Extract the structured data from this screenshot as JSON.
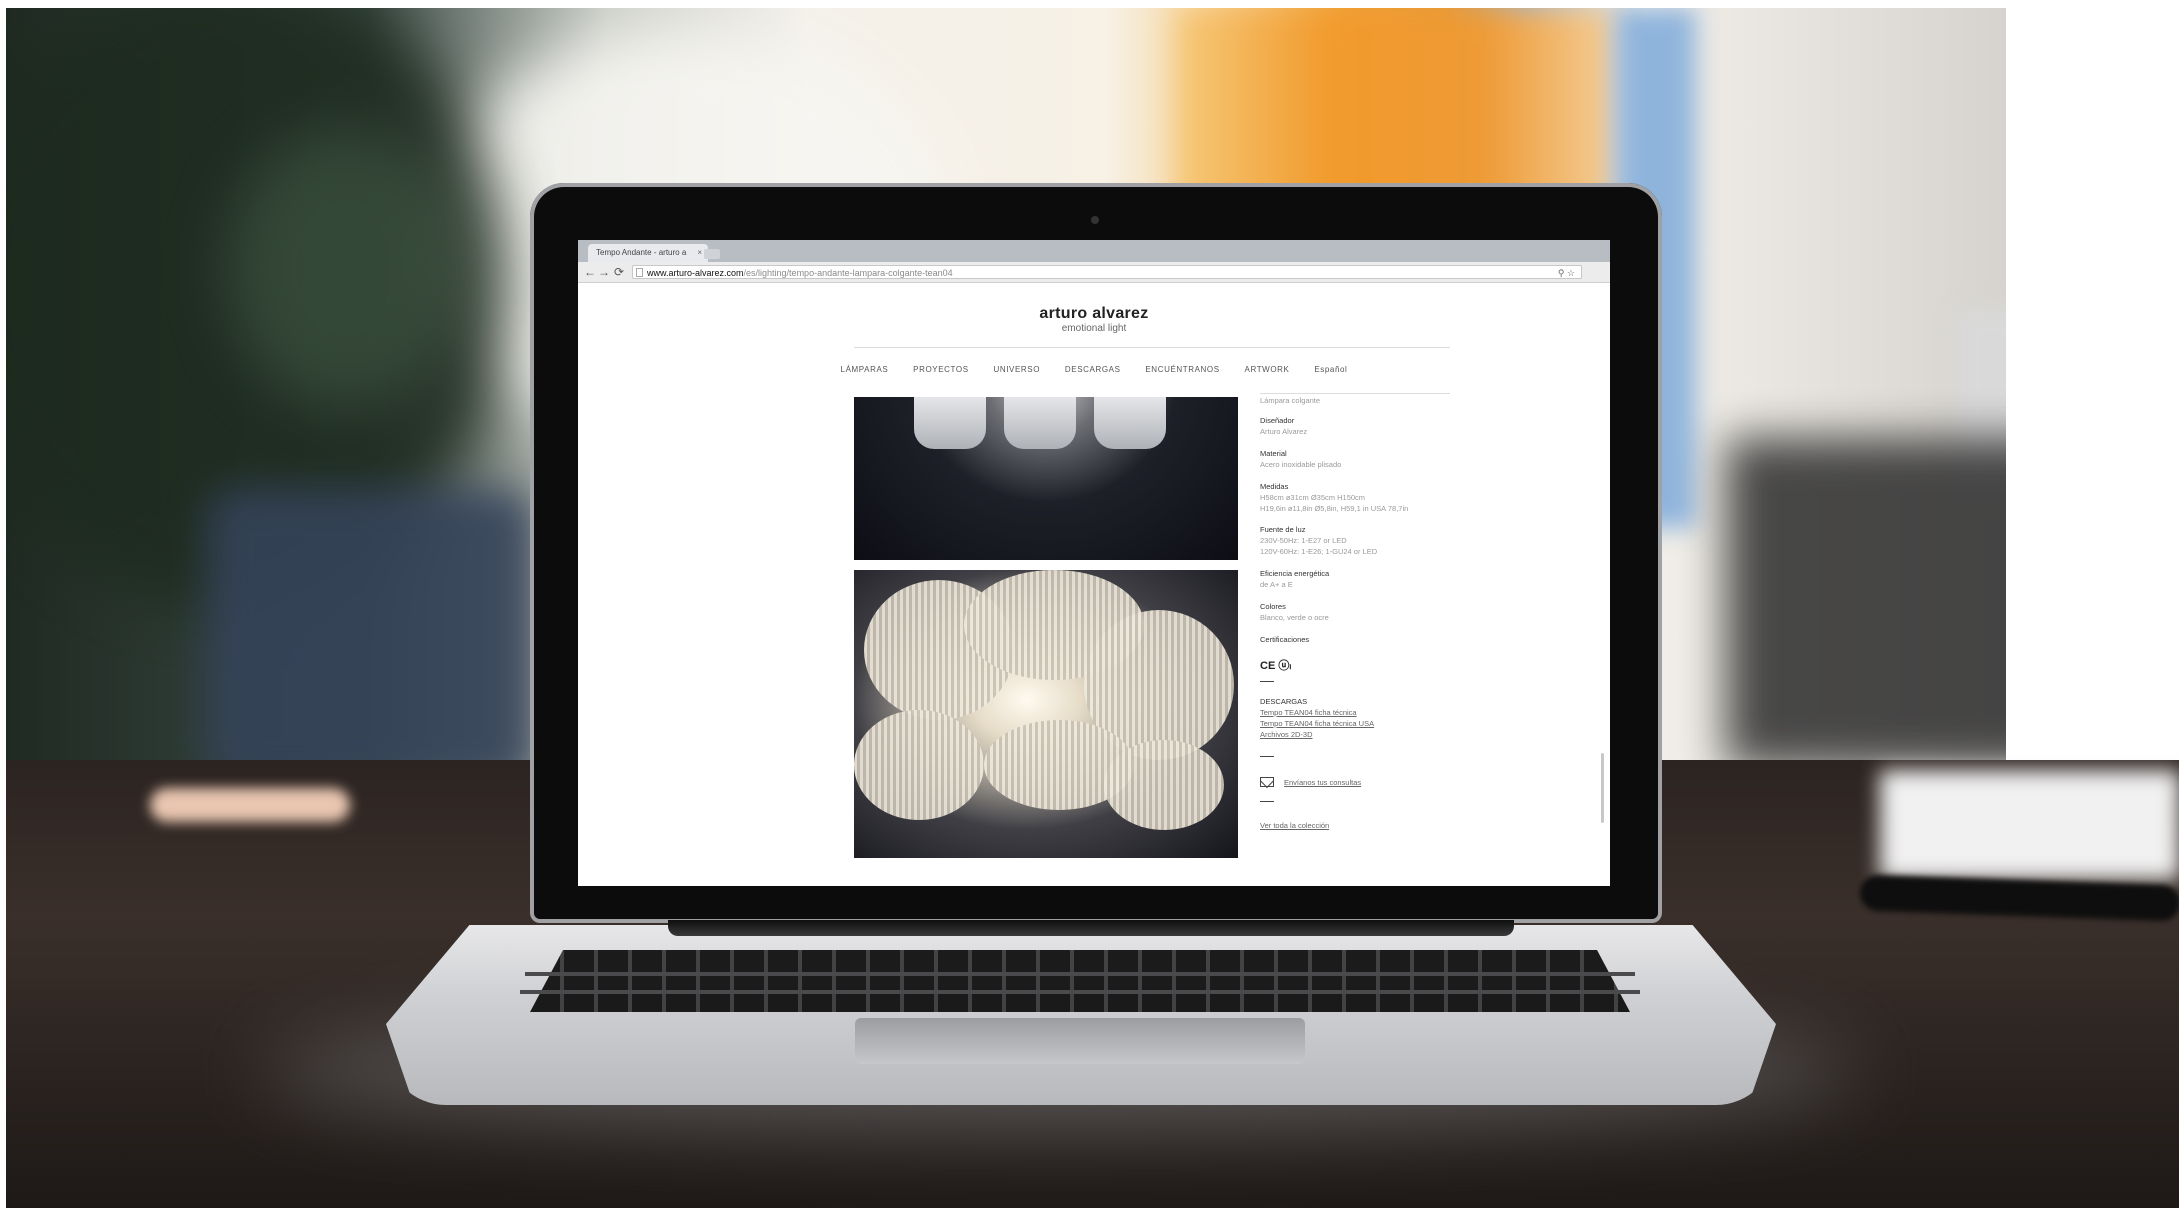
{
  "browser": {
    "tab_title": "Tempo Andante - arturo a",
    "tab_close": "×",
    "back": "←",
    "forward": "→",
    "reload": "⟳",
    "url_host": "www.arturo-alvarez.com",
    "url_path": "/es/lighting/tempo-andante-lampara-colgante-tean04",
    "url_icons": "⚲ ☆"
  },
  "site": {
    "brand_title": "arturo alvarez",
    "brand_sub": "emotional light",
    "nav": [
      "LÁMPARAS",
      "PROYECTOS",
      "UNIVERSO",
      "DESCARGAS",
      "ENCUÉNTRANOS",
      "ARTWORK",
      "Español"
    ]
  },
  "specs": {
    "type_value": "Lámpara colgante",
    "designer_label": "Diseñador",
    "designer_value": "Arturo Alvarez",
    "material_label": "Material",
    "material_value": "Acero inoxidable plisado",
    "measures_label": "Medidas",
    "measures_value_1": "H58cm ø31cm Ø35cm H150cm",
    "measures_value_2": "H19,6in ø11,8in Ø5,8in, H59,1 in USA 78,7in",
    "light_label": "Fuente de luz",
    "light_value_1": "230V-50Hz: 1-E27 or LED",
    "light_value_2": "120V-60Hz: 1-E26; 1-GU24 or LED",
    "efficiency_label": "Eficiencia energética",
    "efficiency_value": "de A+ a E",
    "colors_label": "Colores",
    "colors_value": "Blanco, verde o ocre",
    "certs_label": "Certificaciones",
    "cert_icons": "CE ⓤₗ",
    "downloads_label": "DESCARGAS",
    "download_1": "Tempo TEAN04 ficha técnica",
    "download_2": "Tempo TEAN04 ficha técnica USA",
    "download_3": "Archivos 2D-3D",
    "contact_link": "Envíanos tus consultas",
    "collection_link": "Ver toda la colección"
  }
}
